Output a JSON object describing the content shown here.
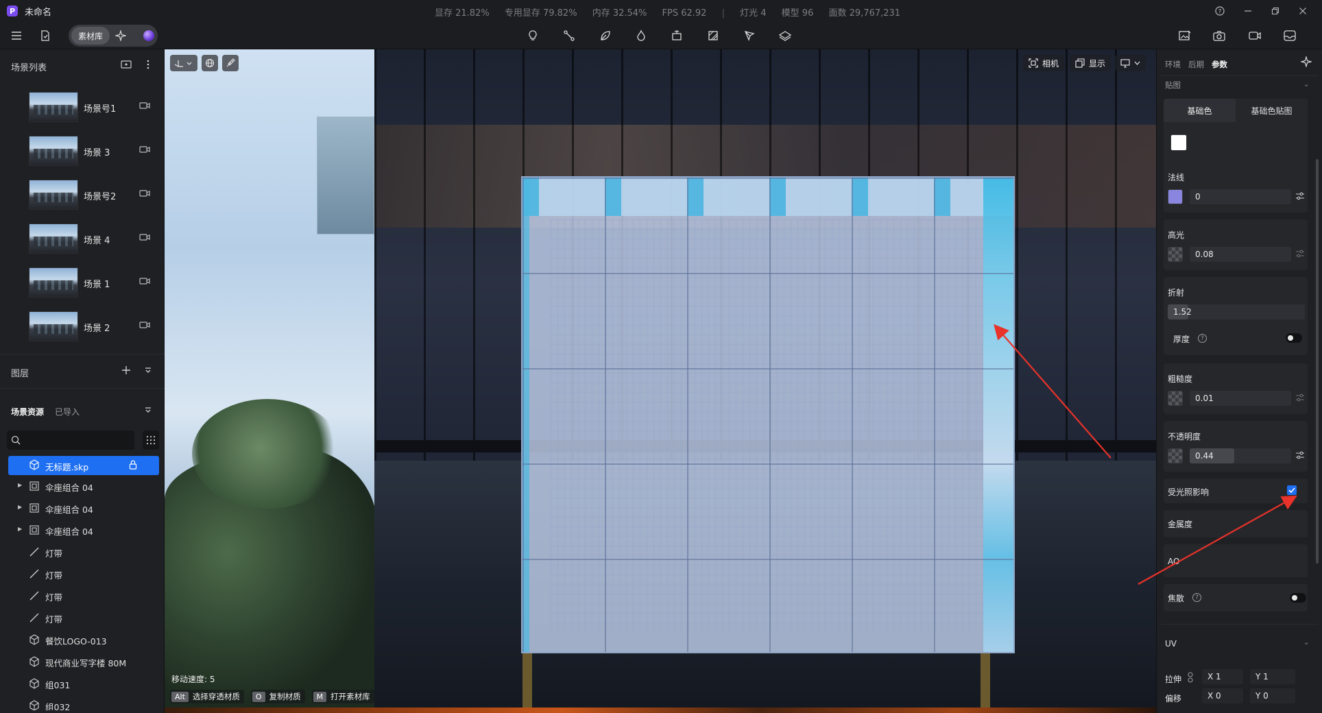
{
  "titlebar": {
    "logo": "P",
    "title": "未命名",
    "stats": [
      "显存 21.82%",
      "专用显存 79.82%",
      "内存 32.54%",
      "FPS 62.92",
      "灯光 4",
      "模型 96",
      "面数 29,767,231"
    ],
    "stats_separator": "|"
  },
  "toolbar": {
    "material_library": "素材库",
    "center_icons": [
      "bulb-icon",
      "path-icon",
      "leaf-icon",
      "fire-icon",
      "stage-icon",
      "pattern-icon",
      "pen-icon",
      "layers-icon"
    ],
    "right_icons": [
      "image-edit-icon",
      "camera-icon",
      "video-icon",
      "inbox-icon"
    ]
  },
  "left_panel": {
    "scene_list_title": "场景列表",
    "scenes": [
      {
        "label": "场景号1"
      },
      {
        "label": "场景 3"
      },
      {
        "label": "场景号2"
      },
      {
        "label": "场景 4"
      },
      {
        "label": "场景 1"
      },
      {
        "label": "场景 2"
      }
    ],
    "layers_title": "图层",
    "assets_tab_active": "场景资源",
    "assets_tab_other": "已导入",
    "search_placeholder": "",
    "tree": [
      {
        "label": "无标题.skp",
        "icon": "cube-icon",
        "selected": true
      },
      {
        "label": "伞座组合 04",
        "icon": "group-icon",
        "expandable": true
      },
      {
        "label": "伞座组合 04",
        "icon": "group-icon",
        "expandable": true
      },
      {
        "label": "伞座组合 04",
        "icon": "group-icon",
        "expandable": true
      },
      {
        "label": "灯带",
        "icon": "line-icon"
      },
      {
        "label": "灯带",
        "icon": "line-icon"
      },
      {
        "label": "灯带",
        "icon": "line-icon"
      },
      {
        "label": "灯带",
        "icon": "line-icon"
      },
      {
        "label": "餐饮LOGO-013",
        "icon": "cube-icon"
      },
      {
        "label": "现代商业写字楼 80M",
        "icon": "cube-icon"
      },
      {
        "label": "组031",
        "icon": "cube-icon"
      },
      {
        "label": "组032",
        "icon": "cube-icon"
      }
    ]
  },
  "viewport": {
    "camera_label": "相机",
    "display_label": "显示",
    "move_speed": "移动速度: 5",
    "shortcuts": [
      {
        "key": "Alt",
        "label": "选择穿透材质"
      },
      {
        "key": "O",
        "label": "复制材质"
      },
      {
        "key": "M",
        "label": "打开素材库"
      }
    ]
  },
  "right_panel": {
    "tabs": [
      "环境",
      "后期",
      "参数"
    ],
    "active_tab": "参数",
    "texture_section": "贴图",
    "texture_tabs": [
      "基础色",
      "基础色贴图"
    ],
    "base_color": "#ffffff",
    "normal": {
      "label": "法线",
      "value": "0",
      "color": "#8a86e0"
    },
    "specular": {
      "label": "高光",
      "value": "0.08",
      "level": 0.0
    },
    "refraction": {
      "label": "折射",
      "value": "1.52",
      "level": 0.15
    },
    "thickness": {
      "label": "厚度",
      "on": false
    },
    "roughness": {
      "label": "粗糙度",
      "value": "0.01",
      "level": 0.0
    },
    "opacity": {
      "label": "不透明度",
      "value": "0.44",
      "level": 0.44
    },
    "lighting_affect": {
      "label": "受光照影响",
      "checked": true
    },
    "metalness": {
      "label": "金属度"
    },
    "ao": {
      "label": "AO"
    },
    "caustics": {
      "label": "焦散",
      "on": false
    },
    "uv_section": "UV",
    "stretch": {
      "label": "拉伸",
      "x": "X 1",
      "y": "Y 1"
    },
    "offset": {
      "label": "偏移",
      "x": "X 0",
      "y": "Y 0"
    }
  },
  "colors": {
    "accent": "#1e6ff1",
    "annotation_arrow": "#e8322a",
    "panel_bg": "#1f2023"
  }
}
